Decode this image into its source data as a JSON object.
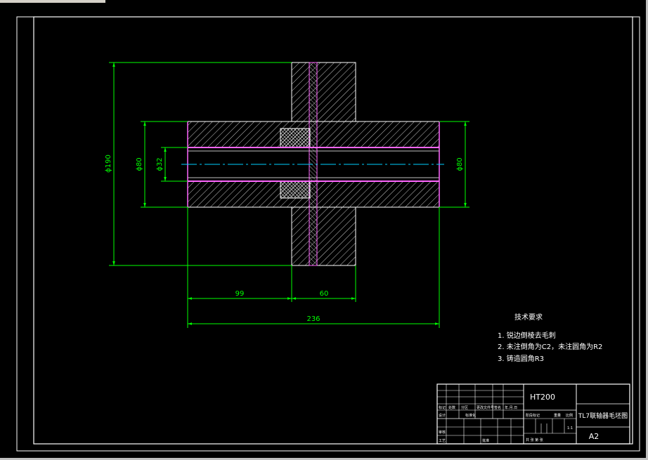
{
  "colors": {
    "background": "#000000",
    "frame": "#ffffff",
    "outline": "#ffffff",
    "hatch": "#c8c8c8",
    "dimension": "#00ff00",
    "centerline": "#00d0ff",
    "bore": "#ff66ff",
    "text": "#ffffff"
  },
  "dimensions": {
    "overall_diameter": "ϕ190",
    "hub_diameter_left": "ϕ80",
    "bore_diameter": "ϕ32",
    "hub_diameter_right": "ϕ80",
    "left_length": "99",
    "right_length": "60",
    "total_length": "236"
  },
  "tech_requirements": {
    "title": "技术要求",
    "items": [
      "1. 锐边倒棱去毛刺",
      "2. 未注倒角为C2，未注圆角为R2",
      "3. 铸造圆角R3"
    ]
  },
  "title_block": {
    "material": "HT200",
    "drawing_name": "TL7联轴器毛坯图",
    "sheet_size": "A2",
    "ratio": "1:1",
    "row_labels": {
      "mark": "标记",
      "count": "处数",
      "zone": "分区",
      "change_doc": "更改文件号",
      "sign": "签名",
      "date": "年.月.日",
      "design": "设计",
      "standardize": "标准化",
      "review": "审核",
      "process": "工艺",
      "approve": "批准",
      "stage_mark": "阶段标记",
      "weight": "重量",
      "scale": "比例",
      "sheets": "共 张 第 张"
    }
  }
}
